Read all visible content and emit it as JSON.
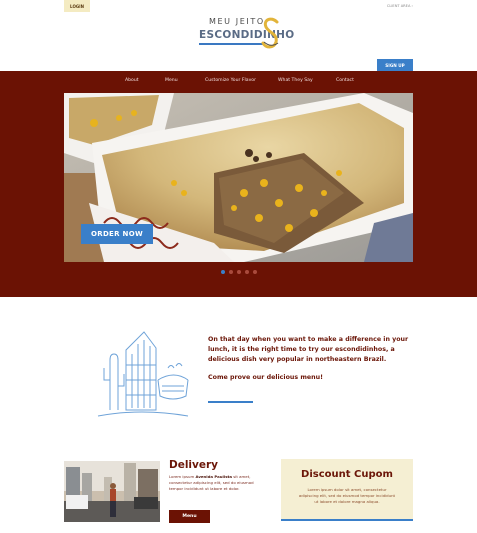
{
  "header": {
    "login_label": "LOGIN",
    "client_area_label": "CLIENT AREA ›",
    "logo_top": "MEU JEITO",
    "logo_main": "ESCONDIDINHO",
    "logo_letter": "S",
    "signup_label": "SIGN UP"
  },
  "nav": {
    "items": [
      "About",
      "Menu",
      "Customize Your Flavor",
      "What They Say",
      "Contact"
    ]
  },
  "hero": {
    "order_label": "ORDER NOW",
    "slides_count": 5,
    "active_slide": 1
  },
  "about": {
    "paragraph": "On that day when you want to make a difference in your lunch, it is the right time to try our escondidinhos, a delicious dish very popular in northeastern Brazil.",
    "cta": "Come prove our delicious menu!"
  },
  "delivery": {
    "title": "Delivery",
    "text_prefix": "Lorem ipsum ",
    "text_bold": "Avenida Paulista",
    "text_rest": " sit amet, consectetur adipiscing elit, sed do eiusmod tempor incididunt ut labore et dolor.",
    "button_label": "Menu"
  },
  "discount": {
    "title": "Discount Cupom",
    "text": "Lorem ipsum dolor sit amet, consectetur adipiscing elit, sed do eiusmod tempor incididunt ut labore et dolore magna aliqua."
  },
  "colors": {
    "brand_red": "#6b1204",
    "accent_blue": "#3a7fc9",
    "cream": "#f5efd3"
  }
}
